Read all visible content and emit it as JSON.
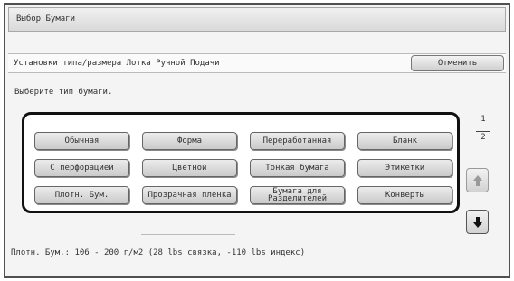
{
  "window": {
    "title": "Выбор Бумаги"
  },
  "subheader": {
    "label": "Установки типа/размера Лотка Ручной Подачи",
    "cancel_label": "Отменить"
  },
  "prompt": "Выберите тип бумаги.",
  "paper_types": [
    "Обычная",
    "Форма",
    "Переработанная",
    "Бланк",
    "С перфорацией",
    "Цветной",
    "Тонкая бумага",
    "Этикетки",
    "Плотн. Бум.",
    "Прозрачная пленка",
    "Бумага для\nРазделителей",
    "Конверты"
  ],
  "pager": {
    "current": "1",
    "total": "2",
    "up_icon": "arrow-up-icon",
    "down_icon": "arrow-down-icon"
  },
  "info_text": "Плотн. Бум.: 106 - 200 г/м2 (28 lbs связка, -110 lbs индекс)"
}
